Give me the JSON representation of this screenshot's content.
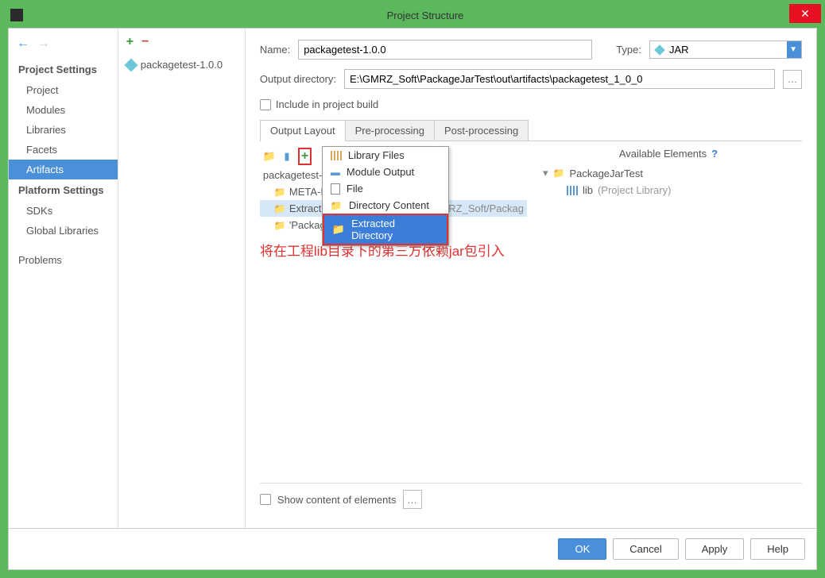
{
  "window": {
    "title": "Project Structure"
  },
  "left_panel": {
    "section1": "Project Settings",
    "items1": [
      "Project",
      "Modules",
      "Libraries",
      "Facets",
      "Artifacts"
    ],
    "section2": "Platform Settings",
    "items2": [
      "SDKs",
      "Global Libraries"
    ],
    "section3": "Problems"
  },
  "mid_panel": {
    "artifact": "packagetest-1.0.0"
  },
  "form": {
    "name_label": "Name:",
    "name_value": "packagetest-1.0.0",
    "type_label": "Type:",
    "type_value": "JAR",
    "output_label": "Output directory:",
    "output_value": "E:\\GMRZ_Soft\\PackageJarTest\\out\\artifacts\\packagetest_1_0_0",
    "include_label": "Include in project build"
  },
  "tabs": [
    "Output Layout",
    "Pre-processing",
    "Post-processing"
  ],
  "layout": {
    "root": "packagetest-",
    "items": [
      "META-INF",
      "Extracted",
      "'PackageJ"
    ],
    "path_hint": "/GMRZ_Soft/Packag"
  },
  "menu": {
    "items": [
      "Library Files",
      "Module Output",
      "File",
      "Directory Content",
      "Extracted Directory"
    ]
  },
  "available": {
    "header": "Available Elements",
    "project": "PackageJarTest",
    "lib": "lib",
    "lib_suffix": "(Project Library)"
  },
  "annotation": "将在工程lib目录下的第三方依赖jar包引入",
  "bottom": {
    "show_content": "Show content of elements"
  },
  "buttons": {
    "ok": "OK",
    "cancel": "Cancel",
    "apply": "Apply",
    "help": "Help"
  }
}
